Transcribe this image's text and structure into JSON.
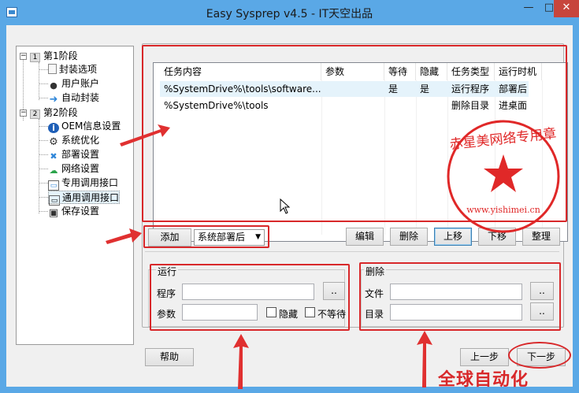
{
  "window": {
    "title": "Easy Sysprep v4.5 - IT天空出品",
    "min": "—",
    "max": "□",
    "close": "✕"
  },
  "tree": {
    "stage1": {
      "num": "1",
      "label": "第1阶段"
    },
    "stage1_items": [
      "封装选项",
      "用户账户",
      "自动封装"
    ],
    "stage2": {
      "num": "2",
      "label": "第2阶段"
    },
    "stage2_items": [
      "OEM信息设置",
      "系统优化",
      "部署设置",
      "网络设置",
      "专用调用接口",
      "通用调用接口",
      "保存设置"
    ]
  },
  "table": {
    "headers": [
      "任务内容",
      "参数",
      "等待",
      "隐藏",
      "任务类型",
      "运行时机"
    ],
    "rows": [
      [
        "%SystemDrive%\\tools\\software...",
        "",
        "是",
        "是",
        "运行程序",
        "部署后"
      ],
      [
        "%SystemDrive%\\tools",
        "",
        "",
        "",
        "删除目录",
        "进桌面"
      ]
    ]
  },
  "toolbar": {
    "add": "添加",
    "select_value": "系统部署后",
    "edit": "编辑",
    "delete": "删除",
    "up": "上移",
    "down": "下移",
    "tidy": "整理"
  },
  "run_group": {
    "title": "运行",
    "program_label": "程序",
    "params_label": "参数",
    "browse": "..",
    "hide": "隐藏",
    "nowait": "不等待"
  },
  "del_group": {
    "title": "删除",
    "file_label": "文件",
    "dir_label": "目录",
    "browse": ".."
  },
  "footer": {
    "help": "帮助",
    "prev": "上一步",
    "next": "下一步"
  },
  "stamp": {
    "text": "赤星美网络专用章",
    "url": "www.yishimei.cn"
  },
  "watermark": "全球自动化"
}
